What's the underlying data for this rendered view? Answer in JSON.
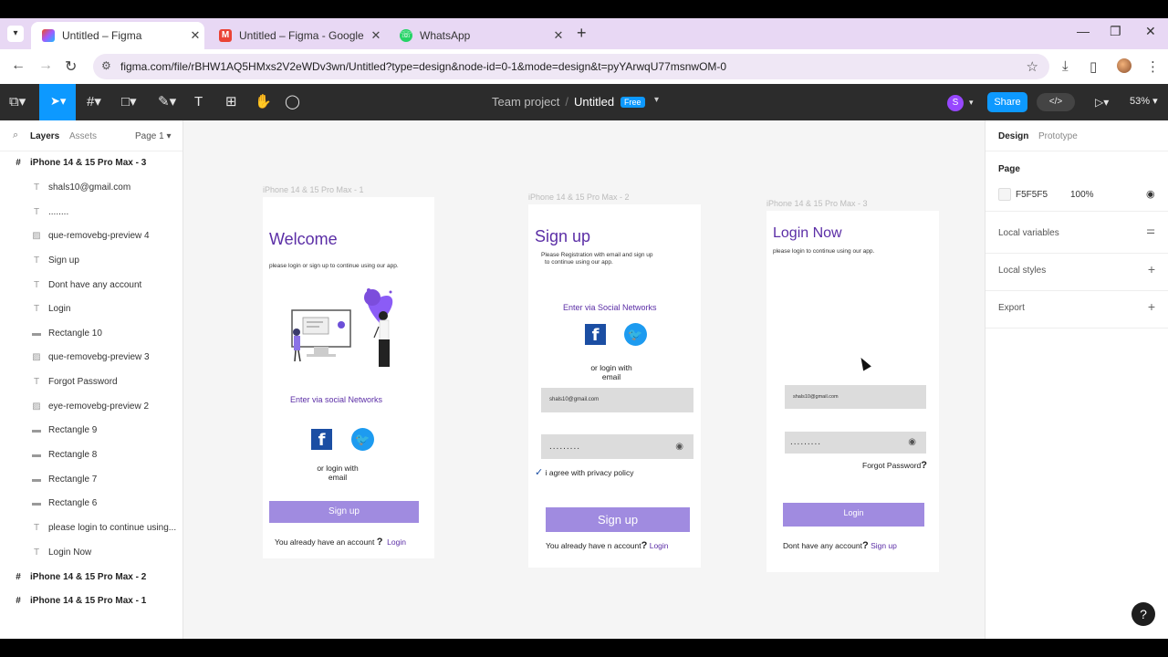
{
  "browser": {
    "tabs": [
      {
        "title": "Untitled – Figma",
        "favicon": "figma-icon",
        "active": true
      },
      {
        "title": "Untitled – Figma - Google Chro",
        "favicon": "gmail-icon",
        "active": false
      },
      {
        "title": "WhatsApp",
        "favicon": "whatsapp-icon",
        "active": false
      }
    ],
    "url": "figma.com/file/rBHW1AQ5HMxs2V2eWDv3wn/Untitled?type=design&node-id=0-1&mode=design&t=pyYArwqU77msnwOM-0"
  },
  "toolbar": {
    "team": "Team project",
    "separator": "/",
    "file": "Untitled",
    "plan_badge": "Free",
    "user_initial": "S",
    "share_label": "Share",
    "zoom": "53%"
  },
  "left_panel": {
    "tabs": {
      "layers": "Layers",
      "assets": "Assets",
      "page": "Page 1"
    },
    "layers": [
      {
        "name": "iPhone 14 & 15 Pro Max - 3",
        "kind": "frame"
      },
      {
        "name": "shals10@gmail.com",
        "kind": "text"
      },
      {
        "name": "........",
        "kind": "text"
      },
      {
        "name": "que-removebg-preview 4",
        "kind": "image"
      },
      {
        "name": "Sign up",
        "kind": "text"
      },
      {
        "name": "Dont have any account",
        "kind": "text"
      },
      {
        "name": "Login",
        "kind": "text"
      },
      {
        "name": "Rectangle 10",
        "kind": "rect"
      },
      {
        "name": "que-removebg-preview 3",
        "kind": "image"
      },
      {
        "name": "Forgot Password",
        "kind": "text"
      },
      {
        "name": "eye-removebg-preview 2",
        "kind": "image"
      },
      {
        "name": "Rectangle 9",
        "kind": "rect"
      },
      {
        "name": "Rectangle 8",
        "kind": "rect"
      },
      {
        "name": "Rectangle 7",
        "kind": "rect"
      },
      {
        "name": "Rectangle 6",
        "kind": "rect"
      },
      {
        "name": "please login to continue using...",
        "kind": "text"
      },
      {
        "name": "Login Now",
        "kind": "text"
      },
      {
        "name": "iPhone 14 & 15 Pro Max - 2",
        "kind": "frame"
      },
      {
        "name": "iPhone 14 & 15 Pro Max - 1",
        "kind": "frame"
      }
    ]
  },
  "canvas": {
    "frame1": {
      "label": "iPhone 14 & 15 Pro Max - 1",
      "title": "Welcome",
      "subtitle": "please login or sign up  to continue using our app.",
      "social_label": "Enter via social Networks",
      "fb": "f",
      "or_email_line1": "or login with",
      "or_email_line2": "email",
      "button": "Sign up",
      "footer_text": "You already have an account",
      "footer_q": "?",
      "footer_link": "Login"
    },
    "frame2": {
      "label": "iPhone 14 & 15 Pro Max - 2",
      "title": "Sign up",
      "subtitle_line1": "Please Registration with email and sign  up",
      "subtitle_line2": "to continue using our app.",
      "social_label": "Enter via Social Networks",
      "fb": "f",
      "or_email_line1": "or login with",
      "or_email_line2": "email",
      "email_value": "shals10@gmail.com",
      "password_value": ".........",
      "check_mark": "✓",
      "agree_text": "i agree with privacy policy",
      "button": "Sign up",
      "footer_text": "You already have n account",
      "footer_q": "?",
      "footer_link": "Login"
    },
    "frame3": {
      "label": "iPhone 14 & 15 Pro Max - 3",
      "title": "Login Now",
      "subtitle": "please login to continue using our app.",
      "email_value": "shals10@gmail.com",
      "password_value": ".........",
      "forgot_text": "Forgot Password",
      "forgot_q": "?",
      "button": "Login",
      "footer_text": "Dont have any account",
      "footer_q": "?",
      "footer_link": "Sign up"
    }
  },
  "right_panel": {
    "tabs": {
      "design": "Design",
      "prototype": "Prototype"
    },
    "page_heading": "Page",
    "page_color": "F5F5F5",
    "page_opacity": "100%",
    "local_variables": "Local variables",
    "local_styles": "Local styles",
    "export": "Export"
  },
  "colors": {
    "accent": "#0d99ff",
    "brand_purple": "#5b2ea6",
    "button_purple": "#a08be0",
    "canvas_bg": "#f5f5f5"
  }
}
